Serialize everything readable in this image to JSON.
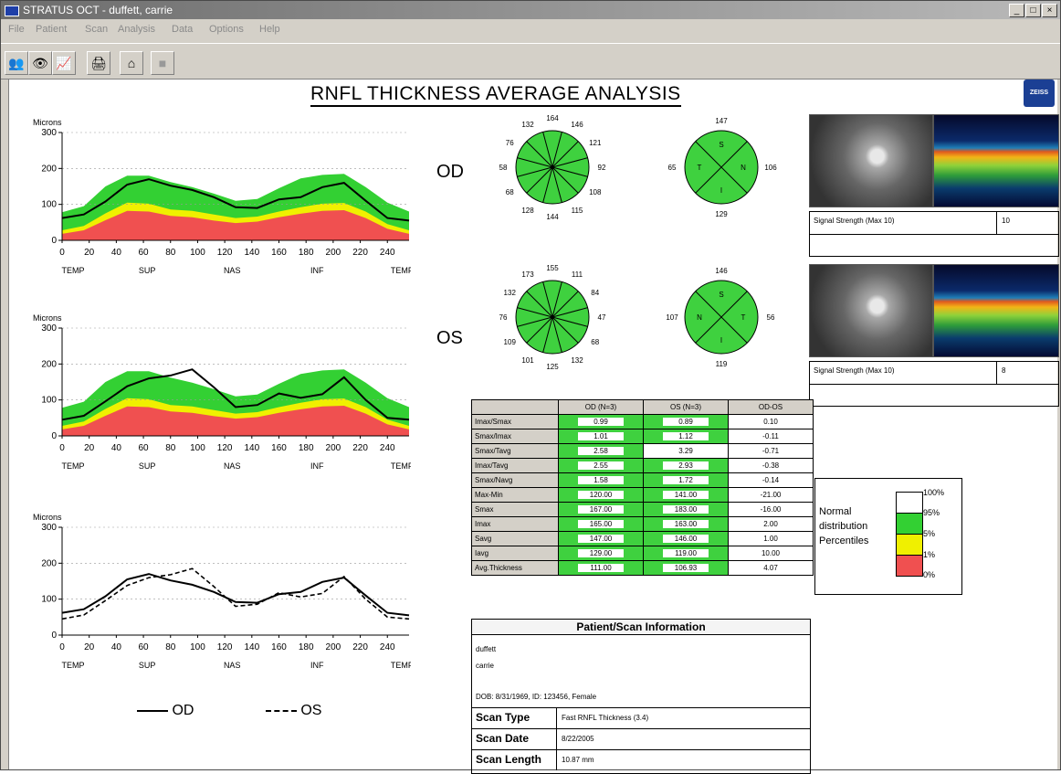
{
  "window": {
    "title": "STRATUS OCT - duffett, carrie",
    "buttons": [
      "_",
      "□",
      "×"
    ]
  },
  "menu": [
    "File",
    "Patient",
    "Scan",
    "Analysis",
    "Data",
    "Options",
    "Help"
  ],
  "toolbar": {
    "icons": [
      "patients-icon",
      "eye-icon",
      "chart-icon",
      "print-icon",
      "home-exit-icon",
      "disabled-icon"
    ]
  },
  "report": {
    "title": "RNFL THICKNESS AVERAGE ANALYSIS",
    "logo_text": "ZEISS"
  },
  "chart_data": [
    {
      "type": "area",
      "id": "od-tsnit",
      "ylabel": "Microns",
      "ylim": [
        0,
        300
      ],
      "xlim": [
        0,
        256
      ],
      "x_ticks": [
        0,
        20,
        40,
        60,
        80,
        100,
        120,
        140,
        160,
        180,
        200,
        220,
        240
      ],
      "y_ticks": [
        0,
        100,
        200,
        300
      ],
      "region_labels": [
        "TEMP",
        "SUP",
        "NAS",
        "INF",
        "TEMP"
      ],
      "x": [
        0,
        16,
        32,
        48,
        64,
        80,
        96,
        112,
        128,
        144,
        160,
        176,
        192,
        208,
        224,
        240,
        256
      ],
      "bands": {
        "p95": [
          78,
          95,
          150,
          180,
          180,
          162,
          148,
          130,
          110,
          115,
          145,
          172,
          182,
          185,
          148,
          105,
          80
        ],
        "p5": [
          28,
          40,
          75,
          105,
          102,
          86,
          82,
          72,
          62,
          66,
          80,
          92,
          102,
          104,
          80,
          45,
          28
        ],
        "p1": [
          18,
          28,
          56,
          82,
          80,
          68,
          64,
          55,
          48,
          52,
          64,
          74,
          82,
          84,
          62,
          32,
          18
        ]
      },
      "series": [
        {
          "name": "OD",
          "values": [
            62,
            72,
            108,
            155,
            170,
            152,
            140,
            120,
            92,
            90,
            114,
            120,
            148,
            160,
            110,
            62,
            55
          ]
        }
      ]
    },
    {
      "type": "area",
      "id": "os-tsnit",
      "ylabel": "Microns",
      "ylim": [
        0,
        300
      ],
      "xlim": [
        0,
        256
      ],
      "x_ticks": [
        0,
        20,
        40,
        60,
        80,
        100,
        120,
        140,
        160,
        180,
        200,
        220,
        240
      ],
      "y_ticks": [
        0,
        100,
        200,
        300
      ],
      "region_labels": [
        "TEMP",
        "SUP",
        "NAS",
        "INF",
        "TEMP"
      ],
      "x": [
        0,
        16,
        32,
        48,
        64,
        80,
        96,
        112,
        128,
        144,
        160,
        176,
        192,
        208,
        224,
        240,
        256
      ],
      "bands": {
        "p95": [
          78,
          95,
          150,
          180,
          180,
          162,
          148,
          130,
          110,
          115,
          145,
          172,
          182,
          185,
          148,
          105,
          80
        ],
        "p5": [
          28,
          40,
          75,
          105,
          102,
          86,
          82,
          72,
          62,
          66,
          80,
          92,
          102,
          104,
          80,
          45,
          28
        ],
        "p1": [
          18,
          28,
          56,
          82,
          80,
          68,
          64,
          55,
          48,
          52,
          64,
          74,
          82,
          84,
          62,
          32,
          18
        ]
      },
      "series": [
        {
          "name": "OS",
          "values": [
            45,
            56,
            96,
            138,
            160,
            168,
            185,
            135,
            80,
            86,
            118,
            106,
            116,
            163,
            100,
            50,
            45
          ]
        }
      ]
    },
    {
      "type": "line",
      "id": "od-os-overlay",
      "ylabel": "Microns",
      "ylim": [
        0,
        300
      ],
      "xlim": [
        0,
        256
      ],
      "x_ticks": [
        0,
        20,
        40,
        60,
        80,
        100,
        120,
        140,
        160,
        180,
        200,
        220,
        240
      ],
      "y_ticks": [
        0,
        100,
        200,
        300
      ],
      "region_labels": [
        "TEMP",
        "SUP",
        "NAS",
        "INF",
        "TEMP"
      ],
      "x": [
        0,
        16,
        32,
        48,
        64,
        80,
        96,
        112,
        128,
        144,
        160,
        176,
        192,
        208,
        224,
        240,
        256
      ],
      "series": [
        {
          "name": "OD",
          "values": [
            62,
            72,
            108,
            155,
            170,
            152,
            140,
            120,
            92,
            90,
            114,
            120,
            148,
            160,
            110,
            62,
            55
          ],
          "style": "solid"
        },
        {
          "name": "OS",
          "values": [
            45,
            56,
            96,
            138,
            160,
            168,
            185,
            135,
            80,
            86,
            118,
            106,
            116,
            163,
            100,
            50,
            45
          ],
          "style": "dashed"
        }
      ],
      "legend": [
        "OD",
        "OS"
      ]
    }
  ],
  "od": {
    "label": "OD",
    "clock_values": [
      "164",
      "146",
      "121",
      "92",
      "108",
      "115",
      "144",
      "128",
      "68",
      "58",
      "76",
      "132"
    ],
    "quadrant_values": {
      "top": "147",
      "right": "106",
      "bottom": "129",
      "left": "65"
    },
    "quadrant_letters": {
      "top": "S",
      "right": "N",
      "bottom": "I",
      "left": "T"
    },
    "signal_label": "Signal Strength (Max 10)",
    "signal_value": "10"
  },
  "os": {
    "label": "OS",
    "clock_values": [
      "155",
      "111",
      "84",
      "47",
      "68",
      "132",
      "125",
      "101",
      "109",
      "76",
      "132",
      "173"
    ],
    "quadrant_values": {
      "top": "146",
      "right": "56",
      "bottom": "119",
      "left": "107"
    },
    "quadrant_letters": {
      "top": "S",
      "right": "T",
      "bottom": "I",
      "left": "N"
    },
    "signal_label": "Signal Strength (Max 10)",
    "signal_value": "8"
  },
  "colors": {
    "p95_band": "#33d033",
    "p5_band": "#f0f000",
    "p1_band": "#f05050",
    "normal_green": "#3fd13f"
  },
  "params_table": {
    "headers": [
      "",
      "OD (N=3)",
      "OS (N=3)",
      "OD-OS"
    ],
    "rows": [
      {
        "label": "Imax/Smax",
        "od": "0.99",
        "os": "0.89",
        "diff": "0.10",
        "od_color": "g",
        "os_color": "g"
      },
      {
        "label": "Smax/Imax",
        "od": "1.01",
        "os": "1.12",
        "diff": "-0.11",
        "od_color": "g",
        "os_color": "g"
      },
      {
        "label": "Smax/Tavg",
        "od": "2.58",
        "os": "3.29",
        "diff": "-0.71",
        "od_color": "g",
        "os_color": "w"
      },
      {
        "label": "Imax/Tavg",
        "od": "2.55",
        "os": "2.93",
        "diff": "-0.38",
        "od_color": "g",
        "os_color": "g"
      },
      {
        "label": "Smax/Navg",
        "od": "1.58",
        "os": "1.72",
        "diff": "-0.14",
        "od_color": "g",
        "os_color": "g"
      },
      {
        "label": "Max-Min",
        "od": "120.00",
        "os": "141.00",
        "diff": "-21.00",
        "od_color": "g",
        "os_color": "g"
      },
      {
        "label": "Smax",
        "od": "167.00",
        "os": "183.00",
        "diff": "-16.00",
        "od_color": "g",
        "os_color": "g"
      },
      {
        "label": "Imax",
        "od": "165.00",
        "os": "163.00",
        "diff": "2.00",
        "od_color": "g",
        "os_color": "g"
      },
      {
        "label": "Savg",
        "od": "147.00",
        "os": "146.00",
        "diff": "1.00",
        "od_color": "g",
        "os_color": "g"
      },
      {
        "label": "Iavg",
        "od": "129.00",
        "os": "119.00",
        "diff": "10.00",
        "od_color": "g",
        "os_color": "g"
      },
      {
        "label": "Avg.Thickness",
        "od": "111.00",
        "os": "106.93",
        "diff": "4.07",
        "od_color": "g",
        "os_color": "g"
      }
    ]
  },
  "percentile_legend": {
    "text_lines": [
      "Normal",
      "distribution",
      "Percentiles"
    ],
    "ticks": [
      "100%",
      "95%",
      "5%",
      "1%",
      "0%"
    ]
  },
  "patient_info": {
    "header": "Patient/Scan Information",
    "last_name": "duffett",
    "first_name": "carrie",
    "dob_line": "DOB: 8/31/1969, ID: 123456, Female",
    "scan_type_label": "Scan Type",
    "scan_type_value": "Fast RNFL Thickness (3.4)",
    "scan_date_label": "Scan Date",
    "scan_date_value": "8/22/2005",
    "scan_length_label": "Scan Length",
    "scan_length_value": "10.87 mm"
  },
  "overlay_legend": {
    "od": "OD",
    "os": "OS"
  }
}
